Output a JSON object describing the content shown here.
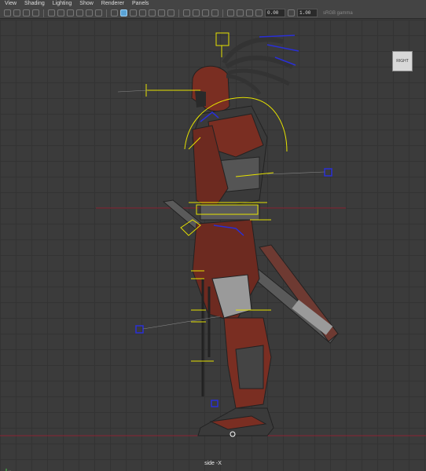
{
  "menubar": {
    "items": [
      "View",
      "Shading",
      "Lighting",
      "Show",
      "Renderer",
      "Panels"
    ]
  },
  "toolbar": {
    "field_a": "0.00",
    "field_b": "1.00",
    "colorspace_label": "sRGB gamma"
  },
  "viewport": {
    "camera_label": "side -X",
    "viewcube_label": "RIGHT"
  },
  "colors": {
    "grid_axis": "#8b2333",
    "rig_yellow": "#e6e200",
    "rig_blue": "#2a2fd6",
    "armor_red": "#7a2e22"
  },
  "icons": [
    "camera-icon",
    "grid-icon",
    "wireframe-icon",
    "shaded-icon",
    "light-icon",
    "xray-icon",
    "isolate-icon"
  ]
}
